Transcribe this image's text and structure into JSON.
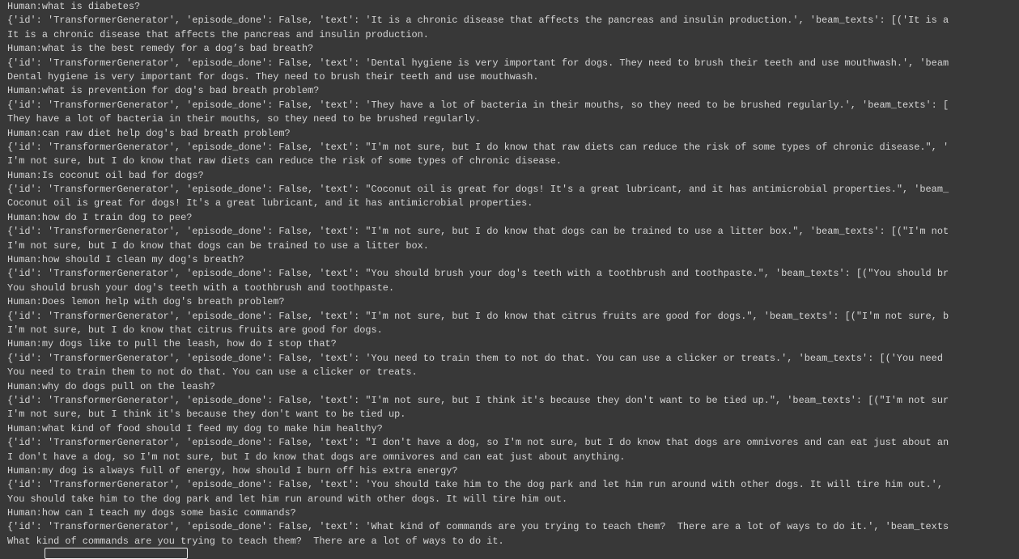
{
  "console": {
    "exchanges": [
      {
        "human": "Human:what is diabetes?",
        "raw": "{'id': 'TransformerGenerator', 'episode_done': False, 'text': 'It is a chronic disease that affects the pancreas and insulin production.', 'beam_texts': [('It is a",
        "reply": "It is a chronic disease that affects the pancreas and insulin production."
      },
      {
        "human": "Human:what is the best remedy for a dog’s bad breath?",
        "raw": "{'id': 'TransformerGenerator', 'episode_done': False, 'text': 'Dental hygiene is very important for dogs. They need to brush their teeth and use mouthwash.', 'beam",
        "reply": "Dental hygiene is very important for dogs. They need to brush their teeth and use mouthwash."
      },
      {
        "human": "Human:what is prevention for dog's bad breath problem?",
        "raw": "{'id': 'TransformerGenerator', 'episode_done': False, 'text': 'They have a lot of bacteria in their mouths, so they need to be brushed regularly.', 'beam_texts': [",
        "reply": "They have a lot of bacteria in their mouths, so they need to be brushed regularly."
      },
      {
        "human": "Human:can raw diet help dog's bad breath problem?",
        "raw": "{'id': 'TransformerGenerator', 'episode_done': False, 'text': \"I'm not sure, but I do know that raw diets can reduce the risk of some types of chronic disease.\", '",
        "reply": "I'm not sure, but I do know that raw diets can reduce the risk of some types of chronic disease."
      },
      {
        "human": "Human:Is coconut oil bad for dogs?",
        "raw": "{'id': 'TransformerGenerator', 'episode_done': False, 'text': \"Coconut oil is great for dogs! It's a great lubricant, and it has antimicrobial properties.\", 'beam_",
        "reply": "Coconut oil is great for dogs! It's a great lubricant, and it has antimicrobial properties."
      },
      {
        "human": "Human:how do I train dog to pee?",
        "raw": "{'id': 'TransformerGenerator', 'episode_done': False, 'text': \"I'm not sure, but I do know that dogs can be trained to use a litter box.\", 'beam_texts': [(\"I'm not",
        "reply": "I'm not sure, but I do know that dogs can be trained to use a litter box."
      },
      {
        "human": "Human:how should I clean my dog's breath?",
        "raw": "{'id': 'TransformerGenerator', 'episode_done': False, 'text': \"You should brush your dog's teeth with a toothbrush and toothpaste.\", 'beam_texts': [(\"You should br",
        "reply": "You should brush your dog's teeth with a toothbrush and toothpaste."
      },
      {
        "human": "Human:Does lemon help with dog's breath problem?",
        "raw": "{'id': 'TransformerGenerator', 'episode_done': False, 'text': \"I'm not sure, but I do know that citrus fruits are good for dogs.\", 'beam_texts': [(\"I'm not sure, b",
        "reply": "I'm not sure, but I do know that citrus fruits are good for dogs."
      },
      {
        "human": "Human:my dogs like to pull the leash, how do I stop that?",
        "raw": "{'id': 'TransformerGenerator', 'episode_done': False, 'text': 'You need to train them to not do that. You can use a clicker or treats.', 'beam_texts': [('You need",
        "reply": "You need to train them to not do that. You can use a clicker or treats."
      },
      {
        "human": "Human:why do dogs pull on the leash?",
        "raw": "{'id': 'TransformerGenerator', 'episode_done': False, 'text': \"I'm not sure, but I think it's because they don't want to be tied up.\", 'beam_texts': [(\"I'm not sur",
        "reply": "I'm not sure, but I think it's because they don't want to be tied up."
      },
      {
        "human": "Human:what kind of food should I feed my dog to make him healthy?",
        "raw": "{'id': 'TransformerGenerator', 'episode_done': False, 'text': \"I don't have a dog, so I'm not sure, but I do know that dogs are omnivores and can eat just about an",
        "reply": "I don't have a dog, so I'm not sure, but I do know that dogs are omnivores and can eat just about anything."
      },
      {
        "human": "Human:my dog is always full of energy, how should I burn off his extra energy?",
        "raw": "{'id': 'TransformerGenerator', 'episode_done': False, 'text': 'You should take him to the dog park and let him run around with other dogs. It will tire him out.',",
        "reply": "You should take him to the dog park and let him run around with other dogs. It will tire him out."
      },
      {
        "human": "Human:how can I teach my dogs some basic commands?",
        "raw": "{'id': 'TransformerGenerator', 'episode_done': False, 'text': 'What kind of commands are you trying to teach them?  There are a lot of ways to do it.', 'beam_texts",
        "reply": "What kind of commands are you trying to teach them?  There are a lot of ways to do it."
      }
    ]
  }
}
